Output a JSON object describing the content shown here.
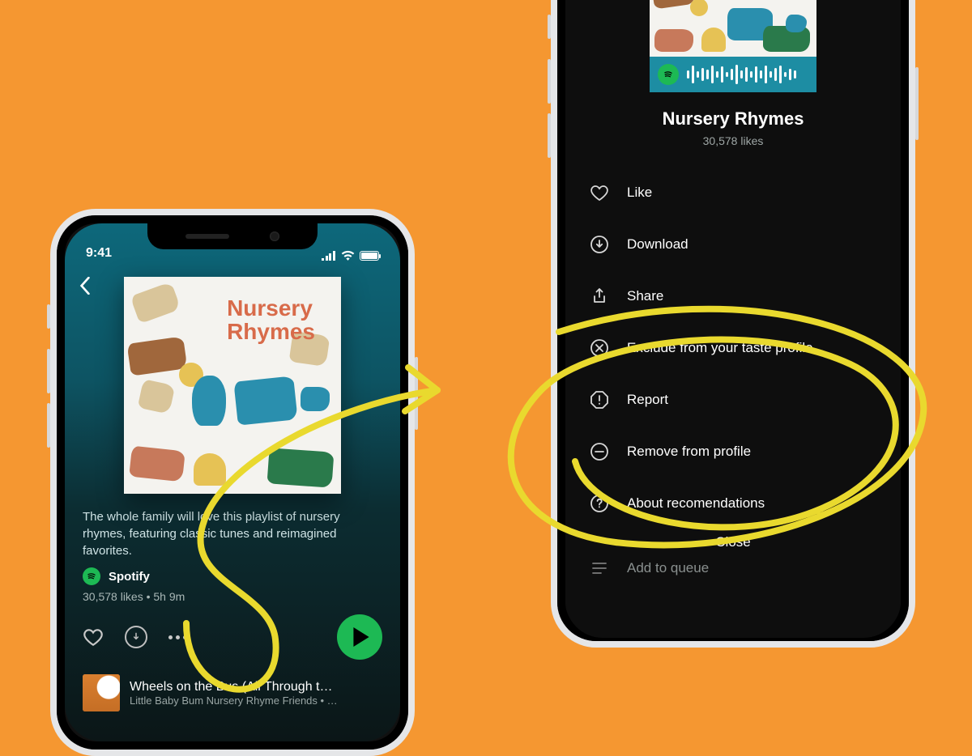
{
  "status": {
    "time": "9:41"
  },
  "playlist": {
    "album_art_title_line1": "Nursery",
    "album_art_title_line2": "Rhymes",
    "description": "The whole family will love this playlist of nursery rhymes, featuring classic tunes and reimagined favorites.",
    "by_label": "Spotify",
    "meta": "30,578 likes • 5h 9m"
  },
  "track": {
    "title": "Wheels on the Bus (All Through t…",
    "artist": "Little Baby Bum Nursery Rhyme Friends • …"
  },
  "context_menu": {
    "title": "Nursery Rhymes",
    "likes": "30,578 likes",
    "items": {
      "like": "Like",
      "download": "Download",
      "share": "Share",
      "exclude": "Exclude from your taste profile",
      "report": "Report",
      "remove": "Remove from profile",
      "about": "About recomendations",
      "queue": "Add to queue"
    },
    "close": "Close"
  }
}
